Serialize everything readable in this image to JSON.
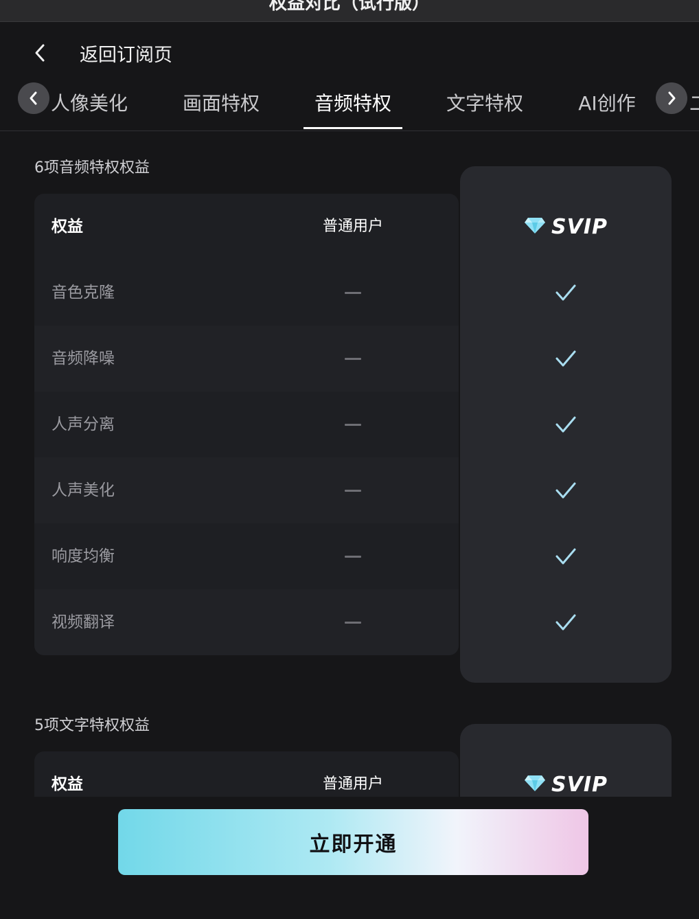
{
  "window": {
    "title": "权益对比（试行版）"
  },
  "nav": {
    "back_label": "返回订阅页"
  },
  "tabs": [
    {
      "label": "人像美化"
    },
    {
      "label": "画面特权"
    },
    {
      "label": "音频特权",
      "active": true
    },
    {
      "label": "文字特权"
    },
    {
      "label": "AI创作"
    },
    {
      "label": "二"
    }
  ],
  "audio_section": {
    "title": "6项音频特权权益",
    "header": {
      "benefit": "权益",
      "normal": "普通用户",
      "svip": "SVIP"
    },
    "rows": [
      {
        "name": "音色克隆",
        "normal": "—",
        "svip": "✓"
      },
      {
        "name": "音频降噪",
        "normal": "—",
        "svip": "✓"
      },
      {
        "name": "人声分离",
        "normal": "—",
        "svip": "✓"
      },
      {
        "name": "人声美化",
        "normal": "—",
        "svip": "✓"
      },
      {
        "name": "响度均衡",
        "normal": "—",
        "svip": "✓"
      },
      {
        "name": "视频翻译",
        "normal": "—",
        "svip": "✓"
      }
    ]
  },
  "text_section": {
    "title": "5项文字特权权益",
    "header": {
      "benefit": "权益",
      "normal": "普通用户",
      "svip": "SVIP"
    }
  },
  "cta": {
    "label": "立即开通"
  },
  "colors": {
    "background": "#161618",
    "table_bg": "#1e1f23",
    "svip_column_bg": "#28292e",
    "check": "#a9ddf0",
    "cta_gradient_start": "#72d8e9",
    "cta_gradient_end": "#efc6e6"
  },
  "icons": [
    "back-chevron-icon",
    "tab-prev-icon",
    "tab-next-icon",
    "diamond-icon",
    "check-icon",
    "dash-icon"
  ]
}
